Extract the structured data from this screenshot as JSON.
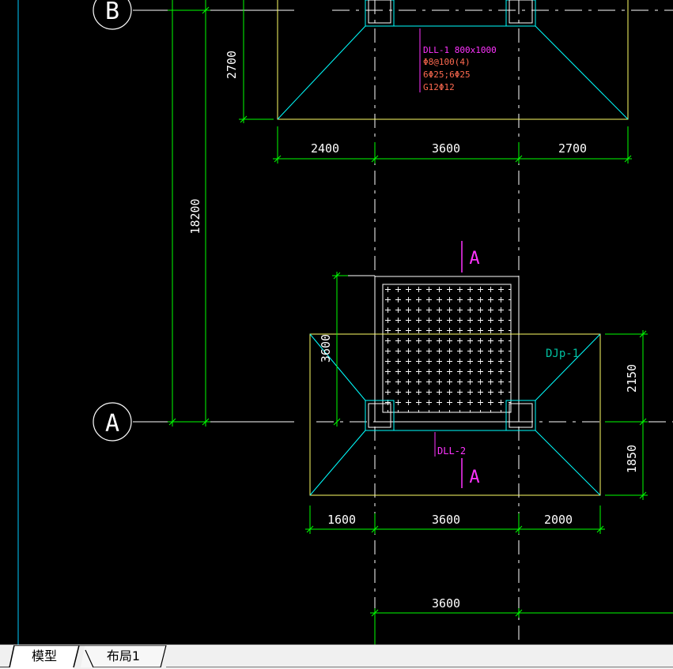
{
  "colors": {
    "background": "#000000",
    "dimension": "#00ff00",
    "foundation_outline": "#ffff66",
    "slope_edge": "#00ffff",
    "axis_line": "#ffffff",
    "beam_label": "#ff33ff",
    "rebar_label": "#ff6a50",
    "section_mark": "#ff33ff",
    "djp_label": "#00c0a0",
    "left_border": "#00ccff"
  },
  "grid_axes": {
    "axis_b": "B",
    "axis_a": "A"
  },
  "dimensions": {
    "top_width_left": "2400",
    "top_width_mid": "3600",
    "top_width_right": "2700",
    "top_height": "2700",
    "axis_spacing": "18200",
    "lower_pad_height": "3600",
    "lower_right_upper": "2150",
    "lower_right_lower": "1850",
    "lower_width_left": "1600",
    "lower_width_mid": "3600",
    "lower_width_right": "2000",
    "bottom_span": "3600"
  },
  "labels": {
    "beam_upper_title": "DLL-1 800x1000",
    "beam_upper_stirrup": "Φ8@100(4)",
    "beam_upper_main": "6Φ25;6Φ25",
    "beam_upper_side": "G12Φ12",
    "beam_lower": "DLL-2",
    "foundation": "DJp-1",
    "section_top": "A",
    "section_bottom": "A"
  },
  "tabs": {
    "model": "模型",
    "layout1": "布局1"
  }
}
